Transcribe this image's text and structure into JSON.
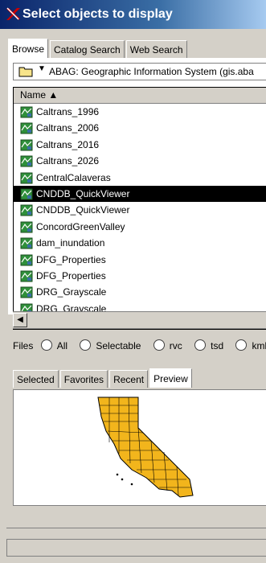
{
  "window": {
    "title": "Select objects to display"
  },
  "tabs": [
    {
      "label": "Browse",
      "active": true
    },
    {
      "label": "Catalog Search",
      "active": false
    },
    {
      "label": "Web Search",
      "active": false
    }
  ],
  "browse": {
    "path": "ABAG: Geographic Information System (gis.aba",
    "column_header": "Name ▲",
    "items": [
      {
        "label": "Caltrans_1996",
        "selected": false
      },
      {
        "label": "Caltrans_2006",
        "selected": false
      },
      {
        "label": "Caltrans_2016",
        "selected": false
      },
      {
        "label": "Caltrans_2026",
        "selected": false
      },
      {
        "label": "CentralCalaveras",
        "selected": false
      },
      {
        "label": "CNDDB_QuickViewer",
        "selected": true
      },
      {
        "label": "CNDDB_QuickViewer",
        "selected": false
      },
      {
        "label": "ConcordGreenValley",
        "selected": false
      },
      {
        "label": "dam_inundation",
        "selected": false
      },
      {
        "label": "DFG_Properties",
        "selected": false
      },
      {
        "label": "DFG_Properties",
        "selected": false
      },
      {
        "label": "DRG_Grayscale",
        "selected": false
      },
      {
        "label": "DRG_Grayscale",
        "selected": false
      }
    ]
  },
  "filters": {
    "label": "Files",
    "options": [
      "All",
      "Selectable",
      "rvc",
      "tsd",
      "kml"
    ]
  },
  "preview_tabs": [
    {
      "label": "Selected",
      "active": false
    },
    {
      "label": "Favorites",
      "active": false
    },
    {
      "label": "Recent",
      "active": false
    },
    {
      "label": "Preview",
      "active": true
    }
  ],
  "colors": {
    "title_gradient_start": "#0a246a",
    "selection": "#000000",
    "map_fill": "#f2b51c"
  }
}
